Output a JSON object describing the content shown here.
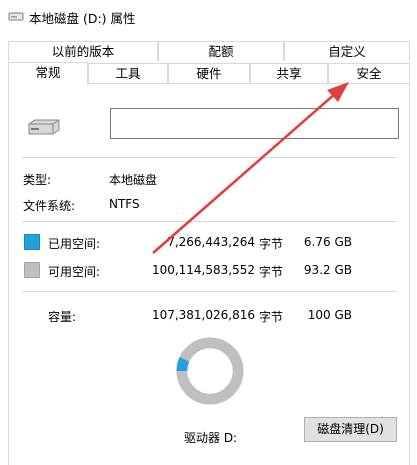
{
  "window": {
    "title": "本地磁盘 (D:) 属性"
  },
  "tabs_top": [
    "以前的版本",
    "配额",
    "自定义"
  ],
  "tabs_bottom": [
    "常规",
    "工具",
    "硬件",
    "共享",
    "安全"
  ],
  "active_tab": "常规",
  "general": {
    "name_value": "",
    "type_label": "类型:",
    "type_value": "本地磁盘",
    "fs_label": "文件系统:",
    "fs_value": "NTFS",
    "used": {
      "label": "已用空间:",
      "bytes": "7,266,443,264",
      "unit": "字节",
      "size": "6.76 GB",
      "color": "#26a0da"
    },
    "free": {
      "label": "可用空间:",
      "bytes": "100,114,583,552",
      "unit": "字节",
      "size": "93.2 GB",
      "color": "#bfbfbf"
    },
    "capacity": {
      "label": "容量:",
      "bytes": "107,381,026,816",
      "unit": "字节",
      "size": "100 GB"
    },
    "used_fraction": 0.0677,
    "drive_label": "驱动器 D:",
    "cleanup_button": "磁盘清理(D)"
  },
  "annotation": {
    "arrow_color": "#e23d3d",
    "points_to": "安全"
  }
}
